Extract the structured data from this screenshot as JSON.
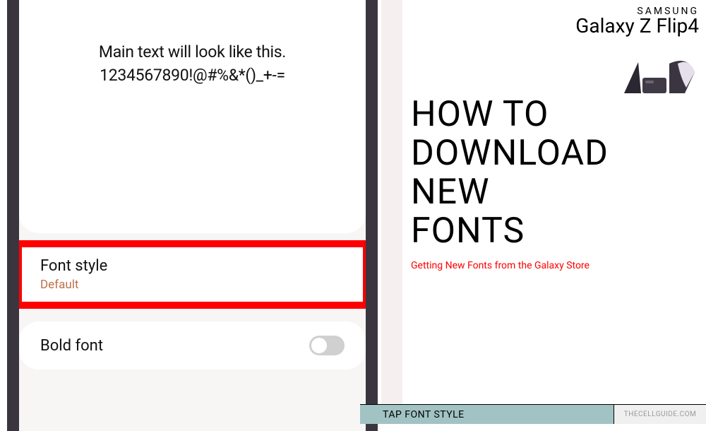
{
  "preview": {
    "line1": "Main text will look like this.",
    "line2": "1234567890!@#%&*()_+-="
  },
  "settings": {
    "font_style": {
      "label": "Font style",
      "value": "Default"
    },
    "bold_font": {
      "label": "Bold font"
    }
  },
  "branding": {
    "maker": "SAMSUNG",
    "product": "Galaxy Z Flip4"
  },
  "heading": {
    "l1": "HOW TO",
    "l2": "DOWNLOAD",
    "l3": "NEW",
    "l4": "FONTS"
  },
  "subtitle": "Getting New Fonts from the Galaxy Store",
  "caption": "TAP FONT STYLE",
  "source": "THECELLGUIDE.COM"
}
